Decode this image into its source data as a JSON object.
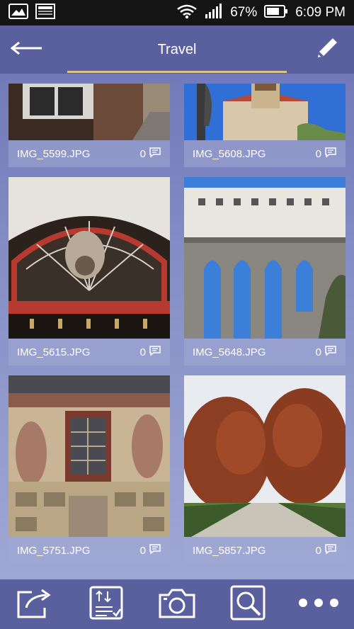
{
  "status_bar": {
    "battery_percent": "67%",
    "time": "6:09 PM",
    "icons": [
      "image-icon",
      "gallery-icon",
      "wifi-icon",
      "signal-icon",
      "battery-icon"
    ]
  },
  "action_bar": {
    "title": "Travel",
    "back_icon": "back-arrow-icon",
    "edit_icon": "pencil-icon",
    "accent_color": "#d9c58a"
  },
  "photos": [
    {
      "filename": "IMG_5599.JPG",
      "comments": "0"
    },
    {
      "filename": "IMG_5608.JPG",
      "comments": "0"
    },
    {
      "filename": "IMG_5615.JPG",
      "comments": "0"
    },
    {
      "filename": "IMG_5648.JPG",
      "comments": "0"
    },
    {
      "filename": "IMG_5751.JPG",
      "comments": "0"
    },
    {
      "filename": "IMG_5857.JPG",
      "comments": "0"
    }
  ],
  "bottom_bar": {
    "icons": [
      "share-icon",
      "sort-icon",
      "camera-icon",
      "search-icon",
      "more-icon"
    ]
  }
}
